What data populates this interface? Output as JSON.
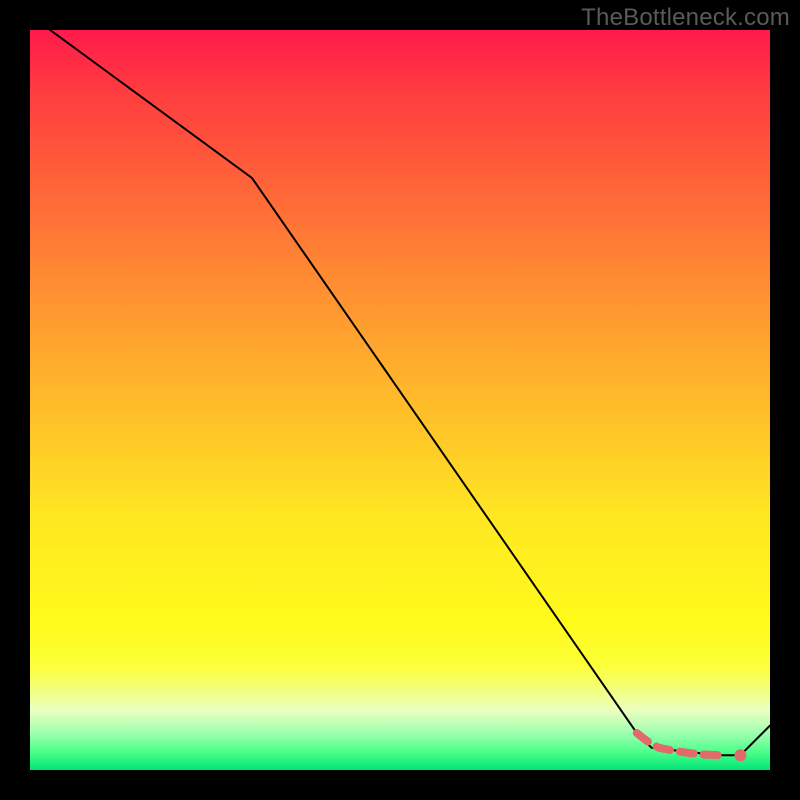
{
  "watermark": "TheBottleneck.com",
  "chart_data": {
    "type": "line",
    "title": "",
    "xlabel": "",
    "ylabel": "",
    "xlim": [
      0,
      100
    ],
    "ylim": [
      0,
      100
    ],
    "series": [
      {
        "name": "bottleneck-curve",
        "color": "#000000",
        "width": 2,
        "x": [
          0,
          30,
          82,
          84,
          93,
          96,
          100
        ],
        "y": [
          102,
          80,
          5,
          3,
          2,
          2,
          6
        ]
      },
      {
        "name": "bottleneck-highlight",
        "color": "#e26a6a",
        "width": 8,
        "x": [
          82,
          83,
          84,
          85,
          87,
          89,
          91,
          93
        ],
        "y": [
          5,
          4.2,
          3.5,
          3,
          2.6,
          2.3,
          2.1,
          2
        ]
      }
    ],
    "markers": [
      {
        "name": "optimal-point",
        "x": 96,
        "y": 2,
        "r": 6,
        "color": "#e26a6a"
      }
    ],
    "gradient_stops": [
      {
        "pos": 0,
        "color": "#ff1a4b"
      },
      {
        "pos": 0.5,
        "color": "#ffd026"
      },
      {
        "pos": 0.85,
        "color": "#fffb1a"
      },
      {
        "pos": 1.0,
        "color": "#00e676"
      }
    ]
  }
}
